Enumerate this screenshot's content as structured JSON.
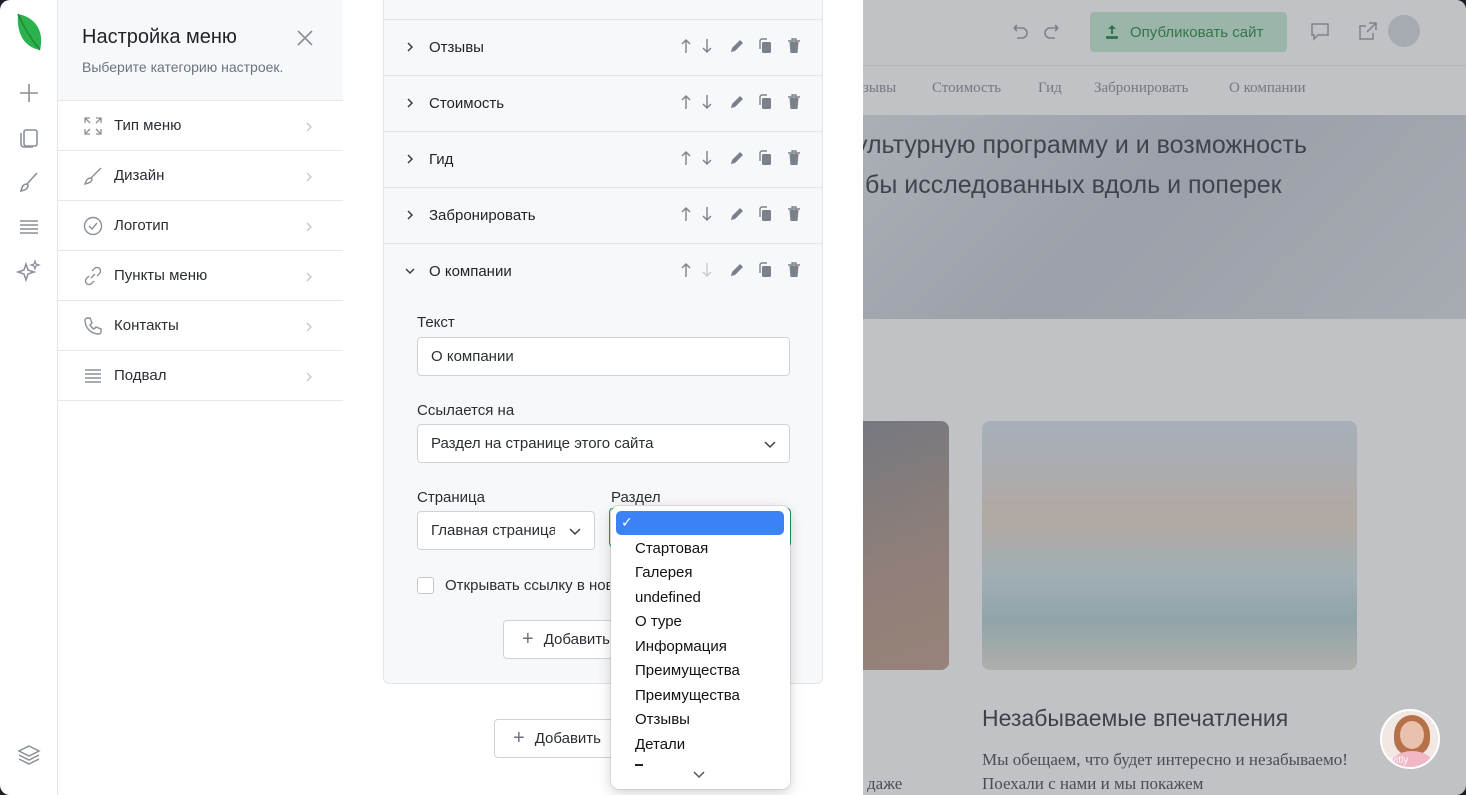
{
  "settings": {
    "title": "Настройка меню",
    "subtitle": "Выберите категорию настроек.",
    "items": [
      {
        "label": "Тип меню",
        "icon": "expand-icon"
      },
      {
        "label": "Дизайн",
        "icon": "brush-icon"
      },
      {
        "label": "Логотип",
        "icon": "check-circle-icon"
      },
      {
        "label": "Пункты меню",
        "icon": "link-icon"
      },
      {
        "label": "Контакты",
        "icon": "phone-icon"
      },
      {
        "label": "Подвал",
        "icon": "footer-icon"
      }
    ]
  },
  "menu_items": {
    "rows": [
      {
        "label": "Отзывы"
      },
      {
        "label": "Стоимость"
      },
      {
        "label": "Гид"
      },
      {
        "label": "Забронировать"
      },
      {
        "label": "О компании"
      }
    ],
    "edit": {
      "text_label": "Текст",
      "text_value": "О компании",
      "links_to_label": "Ссылается на",
      "links_to_value": "Раздел на странице этого сайта",
      "page_label": "Страница",
      "page_value": "Главная страница",
      "section_label": "Раздел",
      "new_tab_label": "Открывать ссылку в новой вкладке",
      "add_sub_label": "Добавить",
      "add_item_label": "Добавить"
    }
  },
  "section_dropdown": {
    "selected": "",
    "options": [
      "Стартовая",
      "Галерея",
      "undefined",
      "О туре",
      "Информация",
      "Преимущества",
      "Преимущества",
      "Отзывы",
      "Детали"
    ]
  },
  "preview": {
    "publish_label": "Опубликовать сайт",
    "nav": [
      "зывы",
      "Стоимость",
      "Гид",
      "Забронировать",
      "О компании"
    ],
    "hero_line1": "ультурную программу и и возможность",
    "hero_line2": "бы исследованных вдоль и поперек",
    "card_title": "Незабываемые впечатления",
    "card_text": "Мы обещаем, что будет интересно и незабываемо! Поехали с нами и мы покажем",
    "left_text": "даже",
    "chat_badge": "kvitly"
  },
  "colors": {
    "accent_green": "#22a455",
    "publish_bg": "#c9ecd4",
    "selection_blue": "#3b82f6"
  }
}
